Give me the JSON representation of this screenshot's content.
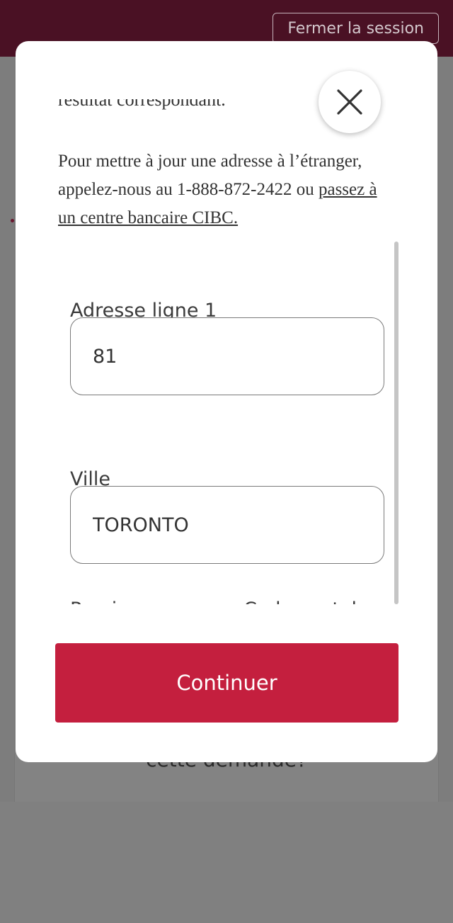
{
  "header": {
    "logout_label": "Fermer la session"
  },
  "background": {
    "lower_text": "cette demande?"
  },
  "modal": {
    "intro_clipped_text": "résultat correspondant.",
    "intro_text": "Pour mettre à jour une adresse à l’étranger, appelez-nous au 1-888-872-2422 ou ",
    "intro_link": "passez à un centre bancaire CIBC.",
    "close_icon": "close-icon",
    "fields": [
      {
        "label": "Adresse ligne 1",
        "value": "81"
      },
      {
        "label": "Ville",
        "value": "TORONTO"
      }
    ],
    "partial_labels": [
      "Province",
      "Code postal"
    ],
    "continue_label": "Continuer"
  },
  "colors": {
    "brand_bar": "#4a1124",
    "primary_button": "#c41f3e"
  }
}
